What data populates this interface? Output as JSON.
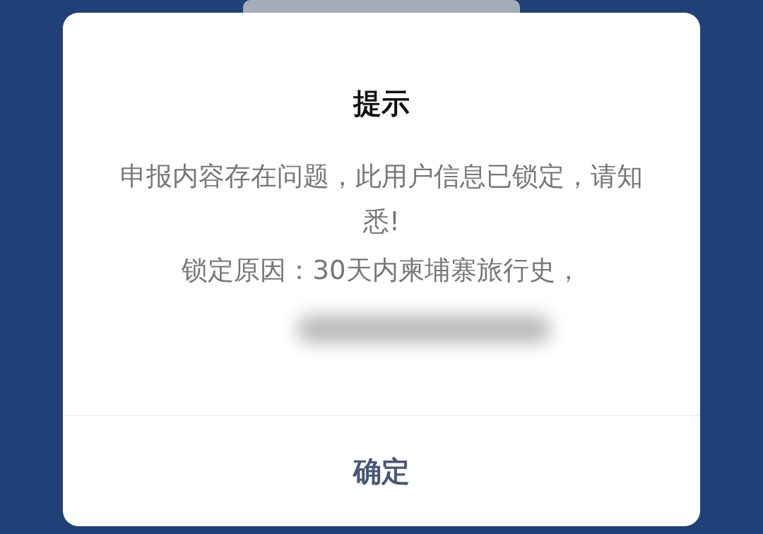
{
  "dialog": {
    "title": "提示",
    "message": "申报内容存在问题，此用户信息已锁定，请知悉!",
    "reason": "锁定原因：30天内柬埔寨旅行史，",
    "buttons": [
      "确定"
    ]
  }
}
